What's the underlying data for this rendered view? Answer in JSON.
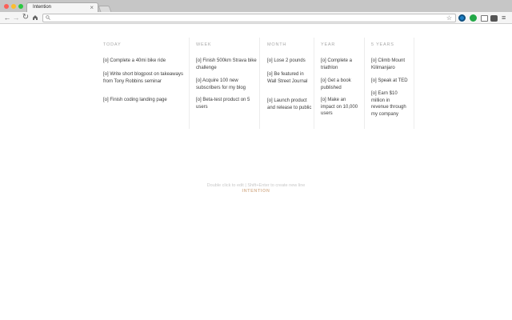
{
  "browser": {
    "tab_title": "Intention",
    "tab_close": "×",
    "menu_glyph": "≡",
    "icons": [
      "back-icon",
      "forward-icon",
      "reload-icon",
      "home-icon",
      "search-icon",
      "star-icon",
      "extension-icon",
      "menu-icon"
    ]
  },
  "columns": [
    {
      "heading": "TODAY",
      "items": [
        "[o] Complete a 40mi bike ride",
        "[o] Write short blogpost on takeaways from Tony Robbins seminar",
        "[o] Finish coding landing page"
      ]
    },
    {
      "heading": "WEEK",
      "items": [
        "[o] Finish 500km Strava bike challenge",
        "[o] Acquire 100 new subscribers for my blog",
        "[o] Beta-test product on 5 users"
      ]
    },
    {
      "heading": "MONTH",
      "items": [
        "[o] Lose 2 pounds",
        "[o] Be featured in Wall Street Journal",
        "[o] Launch product and release to public"
      ]
    },
    {
      "heading": "YEAR",
      "items": [
        "[o] Complete a triathlon",
        "[o] Get a book published",
        "[o] Make an impact on 10,000 users"
      ]
    },
    {
      "heading": "5 YEARS",
      "items": [
        "[o] Climb Mount Kilimanjaro",
        "[o] Speak at TED",
        "[o] Earn $10 million in revenue through my company"
      ]
    }
  ],
  "footer": {
    "hint": "Double click to edit  |  Shift+Enter to create new line",
    "brand": "INTENTION"
  },
  "colors": {
    "accent": "#d9b89a",
    "heading": "#a9a9a9",
    "text": "#3c3c3c"
  }
}
